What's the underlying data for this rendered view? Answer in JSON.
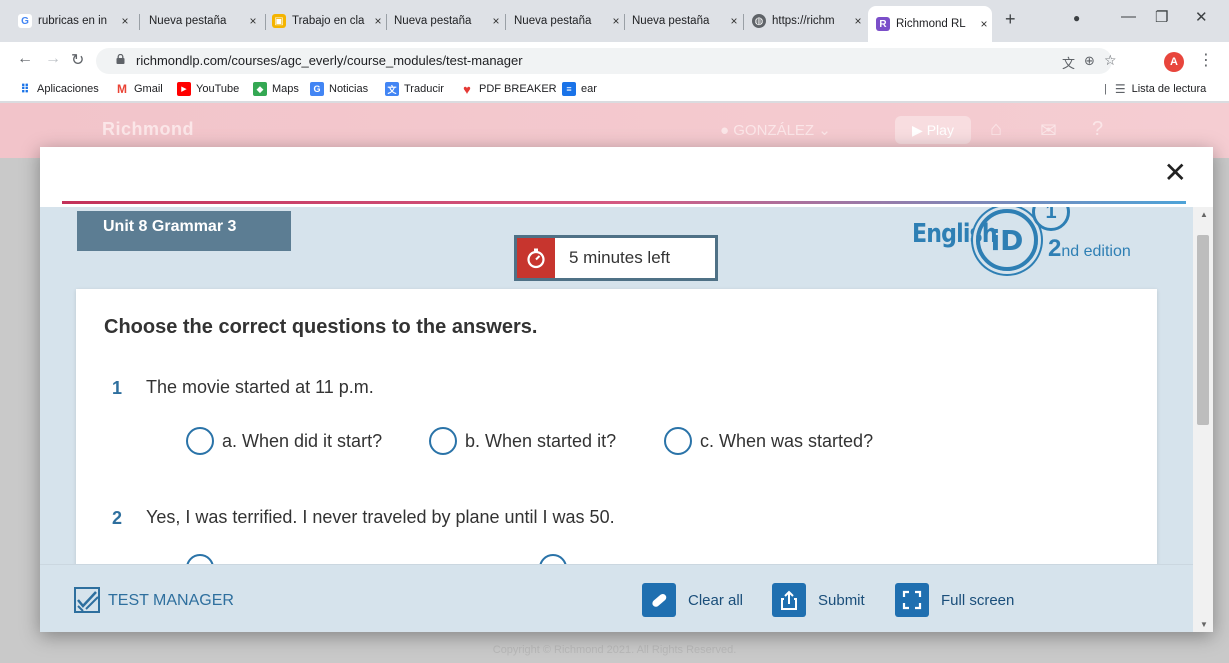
{
  "browser": {
    "tabs": [
      {
        "title": "rubricas en in",
        "favicon": "G",
        "favicon_color": "#4285f4"
      },
      {
        "title": "Nueva pestaña",
        "favicon": "",
        "favicon_color": ""
      },
      {
        "title": "Trabajo en cla",
        "favicon": "▣",
        "favicon_color": "#f4b400"
      },
      {
        "title": "Nueva pestaña",
        "favicon": "",
        "favicon_color": ""
      },
      {
        "title": "Nueva pestaña",
        "favicon": "",
        "favicon_color": ""
      },
      {
        "title": "Nueva pestaña",
        "favicon": "",
        "favicon_color": ""
      },
      {
        "title": "https://richm",
        "favicon": "◍",
        "favicon_color": "#5f6368"
      },
      {
        "title": "Richmond RL",
        "favicon": "R",
        "favicon_color": "#7b4fc9"
      }
    ],
    "close_glyph": "×",
    "new_tab_glyph": "+",
    "url": "richmondlp.com/courses/agc_everly/course_modules/test-manager",
    "profile_initial": "A",
    "bookmarks": [
      {
        "label": "Aplicaciones",
        "icon": "apps-icon",
        "glyph": "⠿",
        "color": "#1a73e8"
      },
      {
        "label": "Gmail",
        "icon": "gmail-icon",
        "glyph": "M",
        "color": "#ea4335"
      },
      {
        "label": "YouTube",
        "icon": "youtube-icon",
        "glyph": "▶",
        "color": "#ff0000"
      },
      {
        "label": "Maps",
        "icon": "maps-icon",
        "glyph": "◆",
        "color": "#34a853"
      },
      {
        "label": "Noticias",
        "icon": "news-icon",
        "glyph": "G",
        "color": "#4285f4"
      },
      {
        "label": "Traducir",
        "icon": "translate-icon",
        "glyph": "文",
        "color": "#4285f4"
      },
      {
        "label": "PDF BREAKER",
        "icon": "heart-icon",
        "glyph": "♥",
        "color": "#e53935"
      },
      {
        "label": "ear",
        "icon": "document-icon",
        "glyph": "≡",
        "color": "#1a73e8"
      }
    ],
    "reading_list": "Lista de lectura"
  },
  "site": {
    "logo": "Richmond",
    "user": "GONZÁLEZ",
    "play": "Play",
    "copyright": "Copyright © Richmond 2021. All Rights Reserved."
  },
  "modal": {
    "close_glyph": "✕",
    "unit_label": "Unit 8 Grammar 3",
    "timer_text": "5 minutes left",
    "brand": {
      "english": "English",
      "id": "iD",
      "level": "1",
      "edition_num": "2",
      "edition_suffix": "nd edition"
    },
    "instructions": "Choose the correct questions to the answers.",
    "questions": [
      {
        "number": "1",
        "text": "The movie started at 11 p.m.",
        "options": [
          "a. When did it start?",
          "b. When started it?",
          "c. When was started?"
        ]
      },
      {
        "number": "2",
        "text": "Yes, I was terrified. I never traveled by plane until I was 50.",
        "options": [
          "",
          ""
        ]
      }
    ],
    "footer": {
      "test_manager": "TEST MANAGER",
      "clear_all": "Clear all",
      "submit": "Submit",
      "full_screen": "Full screen"
    }
  },
  "colors": {
    "accent_blue": "#2e6f9e",
    "unit_bg": "#5c7d93",
    "timer_red": "#c7352e",
    "button_blue": "#1f6fb0",
    "content_bg": "#d6e3ec"
  }
}
